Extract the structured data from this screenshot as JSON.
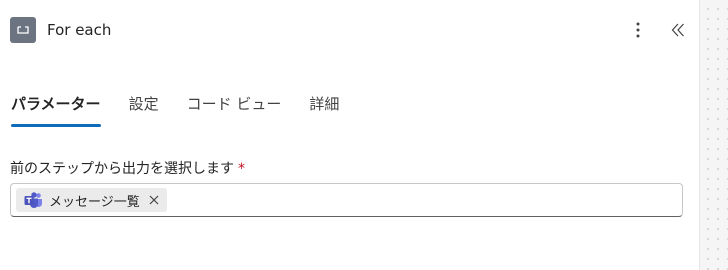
{
  "header": {
    "title": "For each",
    "action_icon": "loop-icon",
    "more_icon": "more-vertical-icon",
    "collapse_icon": "double-chevron-left-icon"
  },
  "tabs": [
    {
      "label": "パラメーター",
      "active": true
    },
    {
      "label": "設定",
      "active": false
    },
    {
      "label": "コード ビュー",
      "active": false
    },
    {
      "label": "詳細",
      "active": false
    }
  ],
  "field": {
    "label": "前のステップから出力を選択します",
    "required_mark": "*",
    "token": {
      "icon": "teams-icon",
      "label": "メッセージ一覧"
    }
  },
  "colors": {
    "accent": "#0f6cbd",
    "required": "#c50f1f",
    "action_icon_bg": "#6b7480",
    "teams": "#5059c9"
  }
}
